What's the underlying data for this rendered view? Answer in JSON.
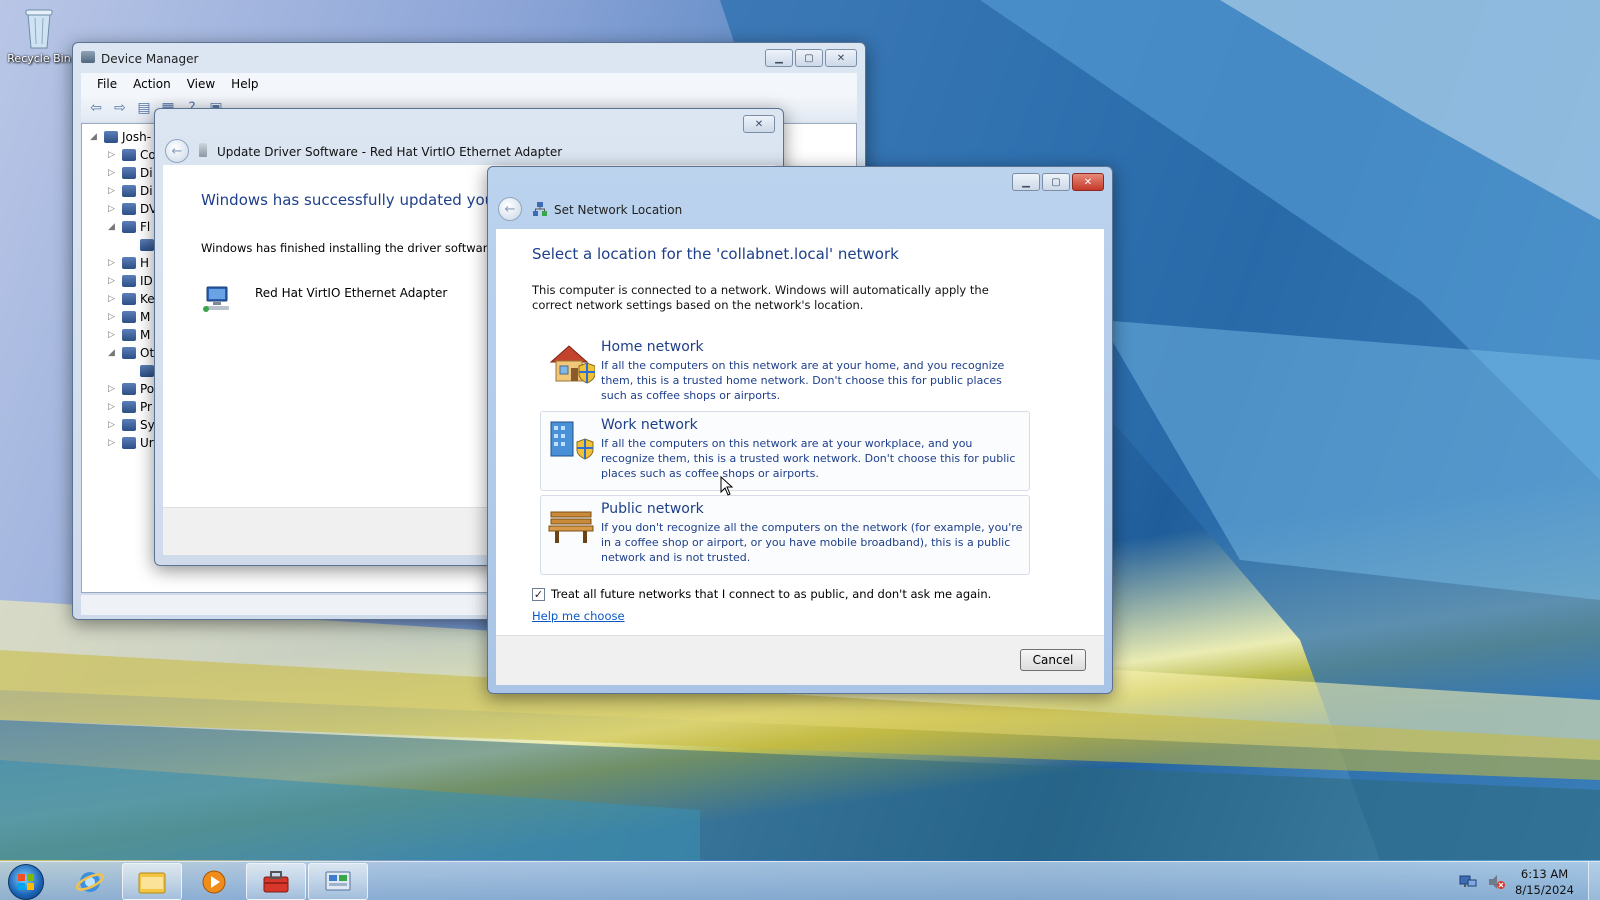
{
  "desktop": {
    "recycle_bin_label": "Recycle Bin"
  },
  "device_manager": {
    "title": "Device Manager",
    "menu": [
      "File",
      "Action",
      "View",
      "Help"
    ],
    "tree": [
      {
        "label": "Josh-",
        "expander": "◢"
      },
      {
        "label": "Co",
        "expander": "▷"
      },
      {
        "label": "Di",
        "expander": "▷"
      },
      {
        "label": "Di",
        "expander": "▷"
      },
      {
        "label": "DV",
        "expander": "▷"
      },
      {
        "label": "Fl",
        "expander": "◢"
      },
      {
        "label": "",
        "expander": ""
      },
      {
        "label": "H",
        "expander": "▷"
      },
      {
        "label": "ID",
        "expander": "▷"
      },
      {
        "label": "Ke",
        "expander": "▷"
      },
      {
        "label": "M",
        "expander": "▷"
      },
      {
        "label": "M",
        "expander": "▷"
      },
      {
        "label": "Ot",
        "expander": "◢"
      },
      {
        "label": "",
        "expander": ""
      },
      {
        "label": "Po",
        "expander": "▷"
      },
      {
        "label": "Pr",
        "expander": "▷"
      },
      {
        "label": "Sy",
        "expander": "▷"
      },
      {
        "label": "Ur",
        "expander": "▷"
      }
    ]
  },
  "update_driver": {
    "title": "Update Driver Software - Red Hat VirtIO Ethernet Adapter",
    "heading": "Windows has successfully updated your d",
    "description": "Windows has finished installing the driver software for",
    "device_name": "Red Hat VirtIO Ethernet Adapter"
  },
  "network_location": {
    "title": "Set Network Location",
    "heading": "Select a location for the 'collabnet.local' network",
    "description": "This computer is connected to a network. Windows will automatically apply the correct network settings based on the network's location.",
    "options": [
      {
        "title": "Home network",
        "description": "If all the computers on this network are at your home, and you recognize them, this is a trusted home network.  Don't choose this for public places such as coffee shops or airports.",
        "icon": "home-network-icon"
      },
      {
        "title": "Work network",
        "description": "If all the computers on this network are at your workplace, and you recognize them, this is a trusted work network.  Don't choose this for public places such as coffee shops or airports.",
        "icon": "work-network-icon"
      },
      {
        "title": "Public network",
        "description": "If you don't recognize all the computers on the network (for example, you're in a coffee shop or airport, or you have mobile broadband), this is a public network and is not trusted.",
        "icon": "public-network-icon"
      }
    ],
    "checkbox_label": "Treat all future networks that I connect to as public, and don't ask me again.",
    "checkbox_checked": true,
    "help_link": "Help me choose",
    "cancel_label": "Cancel"
  },
  "taskbar": {
    "time": "6:13 AM",
    "date": "8/15/2024"
  },
  "colors": {
    "heading_blue": "#1e3f8a",
    "link_blue": "#0a58c4",
    "close_red": "#c4392a"
  }
}
